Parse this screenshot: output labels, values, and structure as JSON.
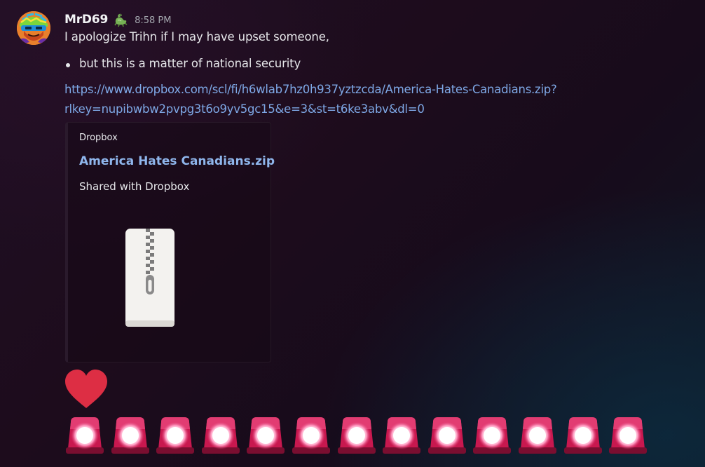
{
  "message": {
    "username": "MrD69",
    "role_icon": "lizard-icon",
    "timestamp": "8:58 PM",
    "line1": "I apologize Trihn if I may have upset someone,",
    "bullet": "but this is a matter of national security",
    "link_line1": "https://www.dropbox.com/scl/fi/h6wlab7hz0h937yztzcda/America-Hates-Canadians.zip?",
    "link_line2": "rlkey=nupibwbw2pvpg3t6o9yv5gc15&e=3&st=t6ke3abv&dl=0"
  },
  "embed": {
    "provider": "Dropbox",
    "title": "America Hates Canadians.zip",
    "description": "Shared with Dropbox",
    "thumbnail_icon": "zip-file-icon"
  },
  "emojis": {
    "heart": "red-heart-emoji",
    "siren": "police-siren-emoji",
    "siren_count": 13
  },
  "colors": {
    "link": "#7ea8e6",
    "embed_title": "#8fb6ec",
    "heart": "#dd2e44",
    "siren": "#d8245a"
  }
}
